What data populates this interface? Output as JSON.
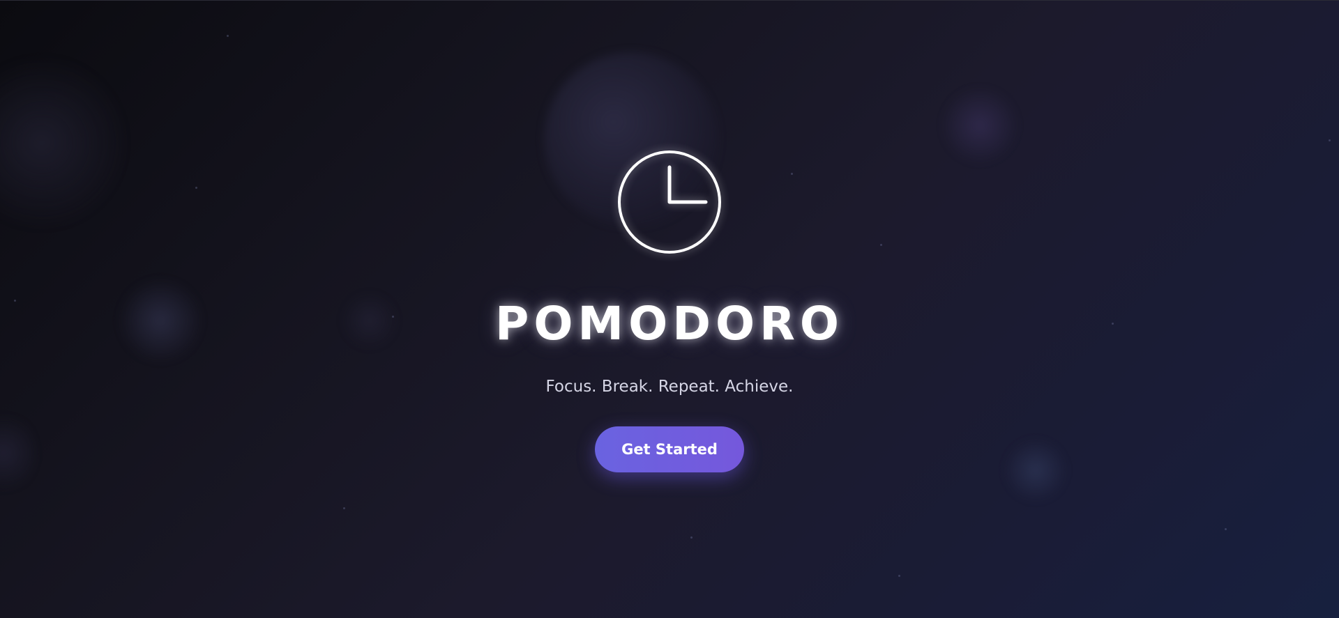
{
  "hero": {
    "icon": "clock-icon",
    "title": "POMODORO",
    "subtitle": "Focus. Break. Repeat. Achieve.",
    "cta_label": "Get Started"
  },
  "colors": {
    "background_start": "#0b0b10",
    "background_end": "#17203f",
    "button_gradient_start": "#6a63e0",
    "button_gradient_end": "#7558dc",
    "title_text": "#ffffff",
    "subtitle_text": "#d6d6e6"
  }
}
